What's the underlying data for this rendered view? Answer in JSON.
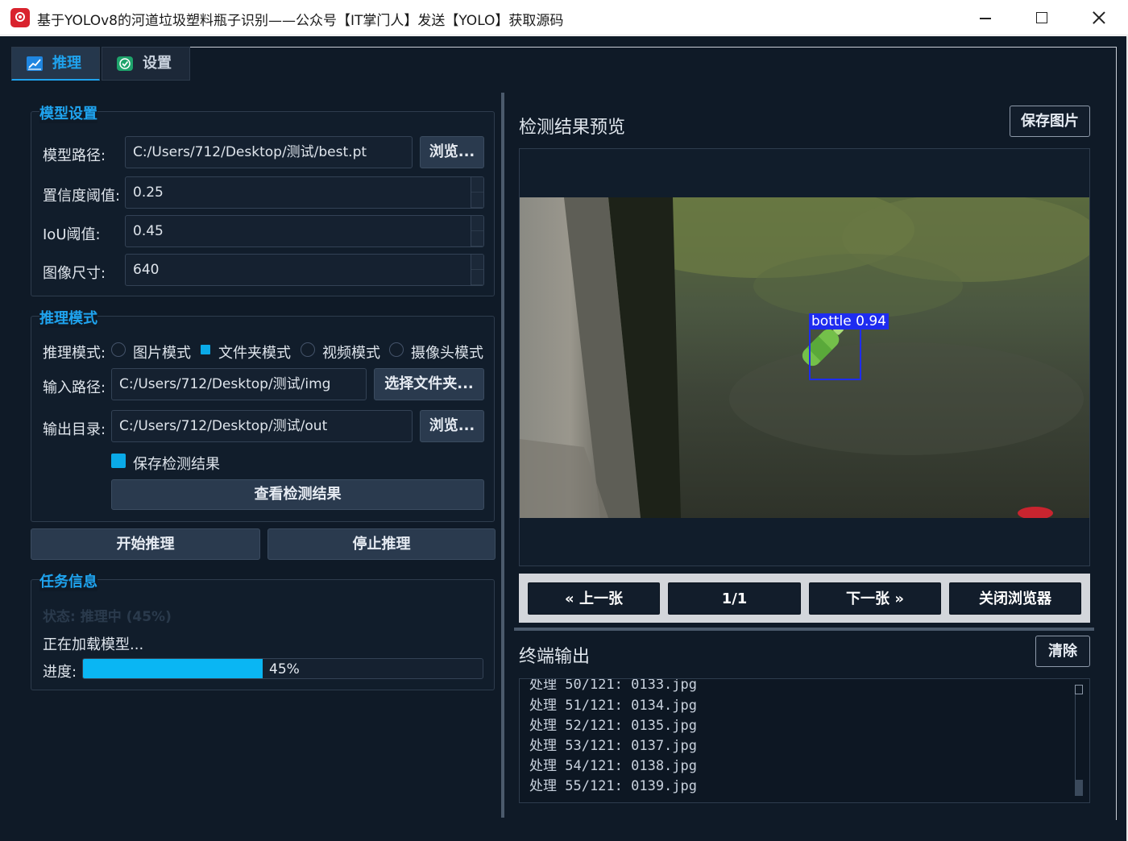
{
  "window": {
    "title": "基于YOLOv8的河道垃圾塑料瓶子识别——公众号【IT掌门人】发送【YOLO】获取源码"
  },
  "tabs": [
    {
      "label": "推理",
      "icon": "chart-icon",
      "active": true
    },
    {
      "label": "设置",
      "icon": "check-icon",
      "active": false
    }
  ],
  "model_settings": {
    "group_title": "模型设置",
    "model_path_label": "模型路径:",
    "model_path_value": "C:/Users/712/Desktop/测试/best.pt",
    "browse_label": "浏览...",
    "confidence_label": "置信度阈值:",
    "confidence_value": "0.25",
    "iou_label": "IoU阈值:",
    "iou_value": "0.45",
    "image_size_label": "图像尺寸:",
    "image_size_value": "640"
  },
  "inference_mode": {
    "group_title": "推理模式",
    "mode_label": "推理模式:",
    "modes": [
      {
        "label": "图片模式",
        "checked": false
      },
      {
        "label": "文件夹模式",
        "checked": true
      },
      {
        "label": "视频模式",
        "checked": false
      },
      {
        "label": "摄像头模式",
        "checked": false
      }
    ],
    "input_path_label": "输入路径:",
    "input_path_value": "C:/Users/712/Desktop/测试/img",
    "select_folder_label": "选择文件夹...",
    "output_dir_label": "输出目录:",
    "output_dir_value": "C:/Users/712/Desktop/测试/out",
    "browse_label": "浏览...",
    "save_results_label": "保存检测结果",
    "save_results_checked": true,
    "view_results_label": "查看检测结果"
  },
  "actions": {
    "start_label": "开始推理",
    "stop_label": "停止推理"
  },
  "task_info": {
    "group_title": "任务信息",
    "status_text": "状态: 推理中 (45%)",
    "message": "正在加载模型...",
    "progress_label": "进度:",
    "progress_value": 0.45,
    "progress_text": "45%"
  },
  "preview": {
    "title": "检测结果预览",
    "save_image_label": "保存图片",
    "detection": {
      "label": "bottle",
      "score": "0.94"
    },
    "colors": {
      "box": "#1e2cf0"
    },
    "nav": {
      "prev_label": "« 上一张",
      "counter": "1/1",
      "next_label": "下一张 »",
      "close_label": "关闭浏览器"
    }
  },
  "terminal": {
    "title": "终端输出",
    "clear_label": "清除",
    "partial_top": "处理 50/121: 0133.jpg",
    "lines": [
      "处理 51/121: 0134.jpg",
      "处理 52/121: 0135.jpg",
      "处理 53/121: 0137.jpg",
      "处理 54/121: 0138.jpg",
      "处理 55/121: 0139.jpg"
    ]
  },
  "theme": {
    "accent": "#1fa3ee",
    "background": "#0f1a27",
    "progress_fill": "#0ab6f3"
  }
}
